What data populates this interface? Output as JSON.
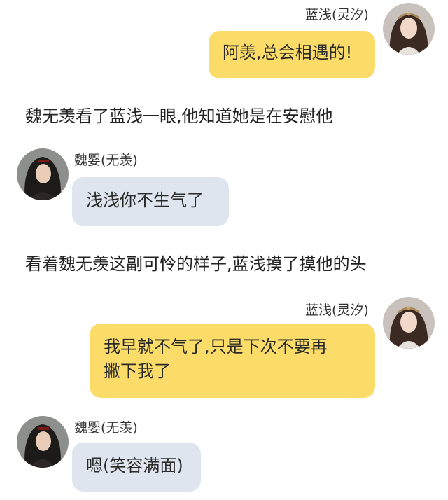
{
  "messages": [
    {
      "type": "chat",
      "side": "right",
      "sender": "蓝浅(灵汐)",
      "avatar_icon": "female-avatar-icon",
      "text": "阿羡,总会相遇的!"
    },
    {
      "type": "narration",
      "text": "魏无羡看了蓝浅一眼,他知道她是在安慰他"
    },
    {
      "type": "chat",
      "side": "left",
      "sender": "魏婴(无羡)",
      "avatar_icon": "male-avatar-icon",
      "text": "浅浅你不生气了"
    },
    {
      "type": "narration",
      "text": "看着魏无羡这副可怜的样子,蓝浅摸了摸他的头"
    },
    {
      "type": "chat",
      "side": "right",
      "sender": "蓝浅(灵汐)",
      "avatar_icon": "female-avatar-icon",
      "text_lines": [
        "我早就不气了,只是下次不要再",
        "撇下我了"
      ]
    },
    {
      "type": "chat",
      "side": "left",
      "sender": "魏婴(无羡)",
      "avatar_icon": "male-avatar-icon",
      "text": "嗯(笑容满面)"
    }
  ],
  "colors": {
    "right_bubble": "#fcdc68",
    "left_bubble": "#dfe5ee",
    "background": "#ffffff"
  }
}
